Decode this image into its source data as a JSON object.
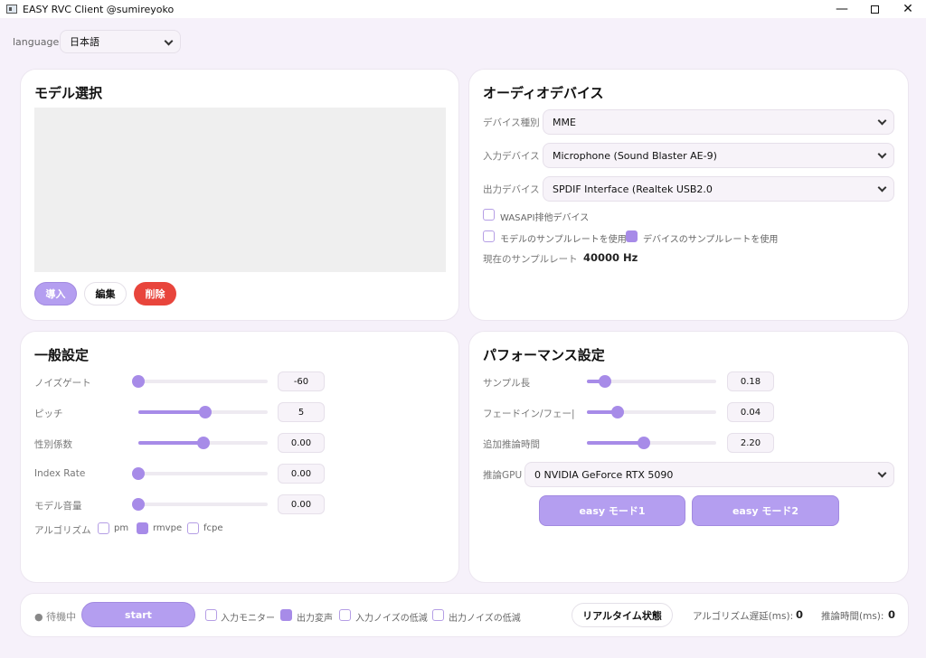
{
  "window": {
    "title": "EASY RVC Client @sumireyoko"
  },
  "language": {
    "label": "language",
    "value": "日本語"
  },
  "model": {
    "title": "モデル選択",
    "import_label": "導入",
    "edit_label": "編集",
    "delete_label": "削除"
  },
  "audio": {
    "title": "オーディオデバイス",
    "device_type_label": "デバイス種別",
    "device_type_value": "MME",
    "input_label": "入力デバイス",
    "input_value": "Microphone (Sound Blaster AE-9)",
    "output_label": "出力デバイス",
    "output_value": "SPDIF Interface (Realtek USB2.0",
    "wasapi_label": "WASAPI排他デバイス",
    "wasapi_checked": false,
    "model_sr_label": "モデルのサンプルレートを使用",
    "model_sr_checked": false,
    "device_sr_label": "デバイスのサンプルレートを使用",
    "device_sr_checked": true,
    "current_sr_label": "現在のサンプルレート",
    "current_sr_value": "40000 Hz"
  },
  "general": {
    "title": "一般設定",
    "sliders": [
      {
        "label": "ノイズゲート",
        "value": "-60",
        "level": 0.0
      },
      {
        "label": "ピッチ",
        "value": "5",
        "level": 0.52
      },
      {
        "label": "性別係数",
        "value": "0.00",
        "level": 0.5
      },
      {
        "label": "Index Rate",
        "value": "0.00",
        "level": 0.0
      },
      {
        "label": "モデル音量",
        "value": "0.00",
        "level": 0.0
      }
    ],
    "algorithm_label": "アルゴリズム",
    "algorithms": [
      {
        "label": "pm",
        "checked": false
      },
      {
        "label": "rmvpe",
        "checked": true
      },
      {
        "label": "fcpe",
        "checked": false
      }
    ]
  },
  "performance": {
    "title": "パフォーマンス設定",
    "sliders": [
      {
        "label": "サンプル長",
        "value": "0.18",
        "level": 0.14
      },
      {
        "label": "フェードイン/フェー|",
        "value": "0.04",
        "level": 0.24
      },
      {
        "label": "追加推論時間",
        "value": "2.20",
        "level": 0.44
      }
    ],
    "gpu_label": "推論GPU",
    "gpu_value": "0 NVIDIA GeForce RTX 5090",
    "easy1_label": "easy モード1",
    "easy2_label": "easy モード2"
  },
  "footer": {
    "status_label": "● 待機中",
    "start_label": "start",
    "input_monitor_label": "入力モニター",
    "input_monitor_checked": false,
    "output_convert_label": "出力変声",
    "output_convert_checked": true,
    "input_noise_label": "入力ノイズの低減",
    "input_noise_checked": false,
    "output_noise_label": "出力ノイズの低減",
    "output_noise_checked": false,
    "realtime_label": "リアルタイム状態",
    "algo_delay_label": "アルゴリズム遅延(ms):",
    "algo_delay_value": "0",
    "infer_time_label": "推論時間(ms):",
    "infer_time_value": "0"
  },
  "colors": {
    "accent": "#a78be8",
    "delete": "#e8453c",
    "background": "#f6f1fa"
  }
}
